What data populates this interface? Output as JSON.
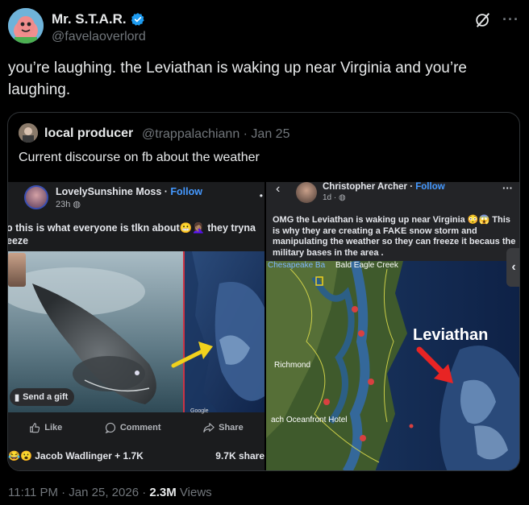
{
  "author": {
    "name": "Mr. S.T.A.R.",
    "handle": "@favelaoverlord",
    "verified": true
  },
  "tweet": {
    "text": "you’re laughing. the Leviathan is waking up near Virginia and you’re laughing."
  },
  "quoted": {
    "name": "local producer",
    "meta": "@trappalachiann · Jan 25",
    "text": "Current discourse on fb about the weather"
  },
  "left_post": {
    "name": "LovelySunshine Moss",
    "follow_label": "Follow",
    "time": "23h",
    "caption_line1": "o this is what everyone is tlkn about😬🤦🏽‍♀️ they tryna",
    "caption_line2": "eeze",
    "gift_label": "Send a gift",
    "google_label": "Google",
    "like_label": "Like",
    "comment_label": "Comment",
    "share_label": "Share",
    "reactions_text": "😂😮 Jacob Wadlinger + 1.7K",
    "shares_text": "9.7K share"
  },
  "right_post": {
    "name": "Christopher Archer",
    "follow_label": "Follow",
    "time": "1d",
    "caption": "OMG the Leviathan is waking up near Virginia 😳😱 This is why they are creating a FAKE snow storm and manipulating the weather so they can freeze it becaus the military bases in the area .",
    "map_labels": {
      "chesapeake": "Chesapeake Ba",
      "bald_eagle": "Bald Eagle Creek",
      "leviathan": "Leviathan",
      "richmond": "Richmond",
      "oceanfront": "ach Oceanfront Hotel"
    }
  },
  "footer": {
    "time": "11:11 PM · Jan 25, 2026 · ",
    "views_count": "2.3M",
    "views_label": " Views"
  },
  "colors": {
    "background": "#000000",
    "verified_blue": "#1d9bf0",
    "fb_link": "#4599ff",
    "secondary_text": "#71767b"
  }
}
